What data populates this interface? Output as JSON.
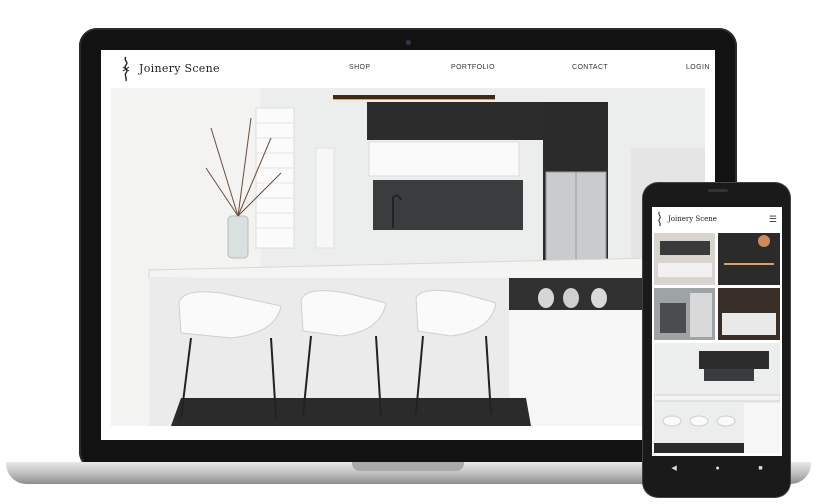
{
  "site": {
    "brand": "Joinery Scene",
    "nav": [
      "SHOP",
      "PORTFOLIO",
      "CONTACT",
      "LOGIN"
    ]
  },
  "hero": {
    "scroll_icon": "chevron-down-icon"
  },
  "phone": {
    "brand": "Joinery Scene",
    "menu_icon": "hamburger-icon",
    "nav_icons": [
      "back-icon",
      "home-icon",
      "recents-icon"
    ]
  },
  "colors": {
    "brand_text": "#222222",
    "device_frame": "#121212"
  }
}
